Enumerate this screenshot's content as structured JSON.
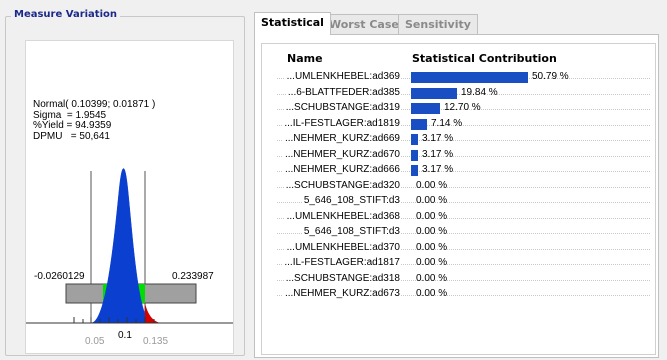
{
  "measure_panel": {
    "title": "Measure Variation",
    "stats": [
      "Normal( 0.10399; 0.01871 )",
      "Sigma  = 1.9545",
      "%Yield = 94.9359",
      "DPMU   = 50,641"
    ],
    "lower_value": "-0.0260129",
    "upper_value": "0.233987",
    "axis_ticks": [
      "0.05",
      "0.1",
      "0.135"
    ]
  },
  "tabs": [
    {
      "label": "Statistical",
      "active": true
    },
    {
      "label": "Worst Case",
      "active": false
    },
    {
      "label": "Sensitivity",
      "active": false
    }
  ],
  "contribution_table": {
    "name_header": "Name",
    "contribution_header": "Statistical Contribution",
    "rows": [
      {
        "name": "...UMLENKHEBEL:ad369",
        "value": "50.79 %",
        "percent": 50.79
      },
      {
        "name": "...6-BLATTFEDER:ad385",
        "value": "19.84 %",
        "percent": 19.84
      },
      {
        "name": "...SCHUBSTANGE:ad319",
        "value": "12.70 %",
        "percent": 12.7
      },
      {
        "name": "...IL-FESTLAGER:ad1819",
        "value": "7.14 %",
        "percent": 7.14
      },
      {
        "name": "...NEHMER_KURZ:ad669",
        "value": "3.17 %",
        "percent": 3.17
      },
      {
        "name": "...NEHMER_KURZ:ad670",
        "value": "3.17 %",
        "percent": 3.17
      },
      {
        "name": "...NEHMER_KURZ:ad666",
        "value": "3.17 %",
        "percent": 3.17
      },
      {
        "name": "...SCHUBSTANGE:ad320",
        "value": "0.00 %",
        "percent": 0
      },
      {
        "name": "5_646_108_STIFT:d3",
        "value": "0.00 %",
        "percent": 0
      },
      {
        "name": "...UMLENKHEBEL:ad368",
        "value": "0.00 %",
        "percent": 0
      },
      {
        "name": "5_646_108_STIFT:d3",
        "value": "0.00 %",
        "percent": 0
      },
      {
        "name": "...UMLENKHEBEL:ad370",
        "value": "0.00 %",
        "percent": 0
      },
      {
        "name": "...IL-FESTLAGER:ad1817",
        "value": "0.00 %",
        "percent": 0
      },
      {
        "name": "...SCHUBSTANGE:ad318",
        "value": "0.00 %",
        "percent": 0
      },
      {
        "name": "...NEHMER_KURZ:ad673",
        "value": "0.00 %",
        "percent": 0
      }
    ]
  },
  "colors": {
    "bar": "#1a4fc4",
    "distribution": "#0a3fd0",
    "tail": "#d40000",
    "in_spec": "#00dd00",
    "out_spec": "#a0a0a0"
  }
}
